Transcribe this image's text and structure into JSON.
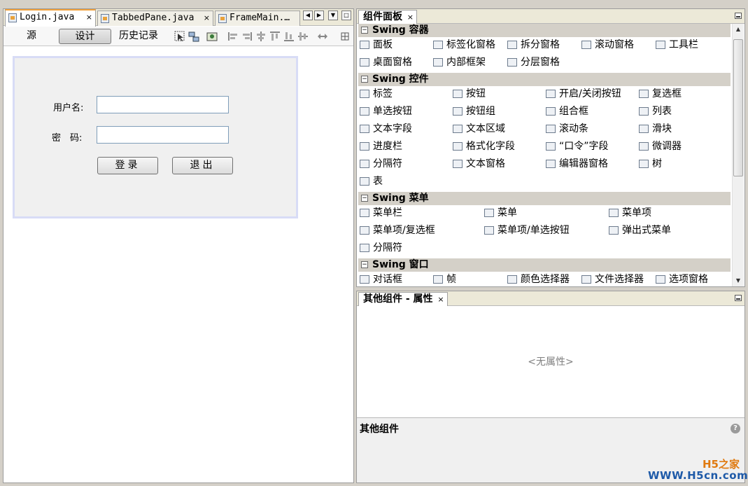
{
  "file_tabs": [
    {
      "label": "Login.java",
      "close": "×"
    },
    {
      "label": "TabbedPane.java",
      "close": "×"
    },
    {
      "label": "FrameMain.…",
      "close": ""
    }
  ],
  "tab_nav": {
    "prev": "◀",
    "next": "▶",
    "menu": "▼",
    "maximize": "□"
  },
  "editor_toolbar": {
    "source": "源",
    "design": "设计",
    "history": "历史记录"
  },
  "form": {
    "username_label": "用户名:",
    "password_label": "密　码:",
    "username_value": "",
    "password_value": "",
    "login_button": "登录",
    "exit_button": "退出"
  },
  "palette": {
    "title": "组件面板",
    "close": "×",
    "categories": [
      {
        "label": "Swing 容器",
        "items": [
          "面板",
          "标签化窗格",
          "拆分窗格",
          "滚动窗格",
          "工具栏",
          "桌面窗格",
          "内部框架",
          "分层窗格"
        ]
      },
      {
        "label": "Swing 控件",
        "items": [
          "标签",
          "按钮",
          "开启/关闭按钮",
          "复选框",
          "单选按钮",
          "按钮组",
          "组合框",
          "列表",
          "文本字段",
          "文本区域",
          "滚动条",
          "滑块",
          "进度栏",
          "格式化字段",
          "“口令”字段",
          "微调器",
          "分隔符",
          "文本窗格",
          "编辑器窗格",
          "树",
          "表"
        ]
      },
      {
        "label": "Swing 菜单",
        "items": [
          "菜单栏",
          "菜单",
          "菜单项",
          "菜单项/复选框",
          "菜单项/单选按钮",
          "弹出式菜单",
          "分隔符"
        ]
      },
      {
        "label": "Swing 窗口",
        "items": [
          "对话框",
          "帧",
          "颜色选择器",
          "文件选择器",
          "选项窗格"
        ]
      }
    ]
  },
  "properties": {
    "title": "其他组件 - 属性",
    "close": "×",
    "empty_text": "<无属性>",
    "footer_label": "其他组件",
    "help": "?"
  },
  "watermark": {
    "line1": "H5之家",
    "line2": "WWW.H5cn.com"
  }
}
